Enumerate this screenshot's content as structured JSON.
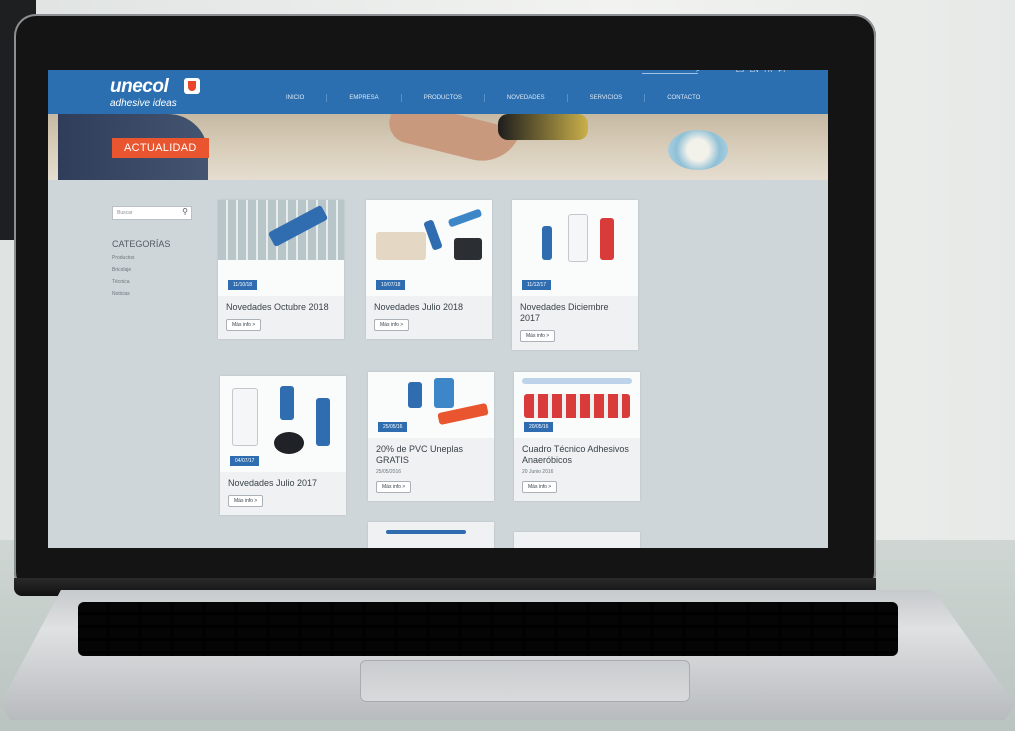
{
  "header": {
    "logo_word": "unecol",
    "logo_tagline": "adhesive ideas",
    "nav": [
      "INICIO",
      "EMPRESA",
      "PRODUCTOS",
      "NOVEDADES",
      "SERVICIOS",
      "CONTACTO"
    ],
    "languages": [
      "ES",
      "EN",
      "FR",
      "PT"
    ]
  },
  "hero": {
    "label": "ACTUALIDAD"
  },
  "sidebar": {
    "search_placeholder": "Buscar",
    "categories_title": "CATEGORÍAS",
    "categories": [
      "Productos",
      "Bricolaje",
      "Técnica",
      "Noticias"
    ]
  },
  "cards": [
    {
      "badge": "11/10/18",
      "title": "Novedades Octubre 2018",
      "more": "Más info >"
    },
    {
      "badge": "10/07/18",
      "title": "Novedades Julio 2018",
      "more": "Más info >"
    },
    {
      "badge": "11/12/17",
      "title": "Novedades Diciembre 2017",
      "more": "Más info >"
    },
    {
      "badge": "04/07/17",
      "title": "Novedades Julio 2017",
      "more": "Más info >"
    },
    {
      "badge": "25/05/16",
      "title": "20% de PVC Uneplas GRATIS",
      "date": "25/05/2016",
      "more": "Más info >"
    },
    {
      "badge": "20/05/16",
      "title": "Cuadro Técnico Adhesivos Anaeróbicos",
      "date": "20 Junio 2016",
      "more": "Más info >"
    }
  ],
  "colors": {
    "brand_blue": "#2b6fb1",
    "accent_orange": "#e8552f"
  }
}
